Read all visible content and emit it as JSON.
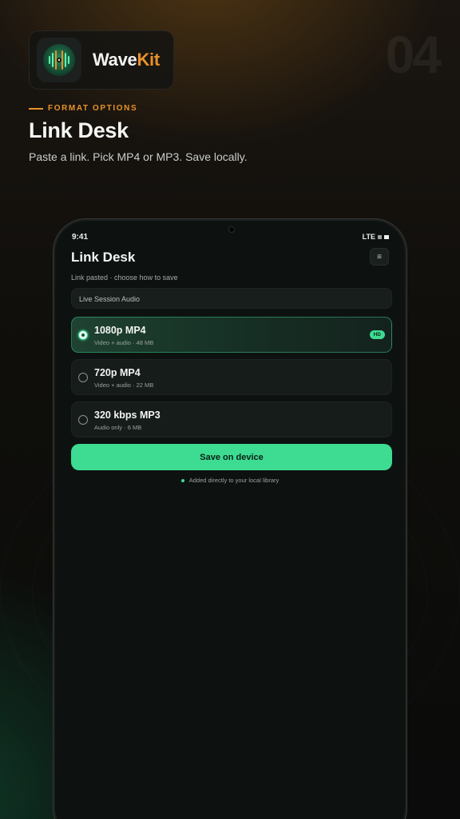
{
  "brand": {
    "name_part1": "Wave",
    "name_part2": "Kit",
    "accent": "#e8922a",
    "icon": "waveform-icon"
  },
  "step_number": "04",
  "header": {
    "eyebrow": "FORMAT OPTIONS",
    "headline": "Link Desk",
    "subtitle": "Paste a link. Pick MP4 or MP3. Save locally."
  },
  "phone": {
    "status": {
      "time": "9:41",
      "network": "LTE"
    },
    "app": {
      "title": "Link Desk",
      "menu_icon": "≡",
      "caption": "Link pasted · choose how to save",
      "file_name": "Live Session Audio",
      "options": [
        {
          "title": "1080p MP4",
          "subtitle": "Video + audio · 48 MB",
          "badge": "HD",
          "selected": true
        },
        {
          "title": "720p MP4",
          "subtitle": "Video + audio · 22 MB",
          "selected": false
        },
        {
          "title": "320 kbps MP3",
          "subtitle": "Audio only · 6 MB",
          "selected": false
        }
      ],
      "save_label": "Save on device",
      "note": "Added directly to your local library"
    }
  },
  "colors": {
    "primary_green": "#3ddc92",
    "screen_bg": "#0d1211"
  }
}
